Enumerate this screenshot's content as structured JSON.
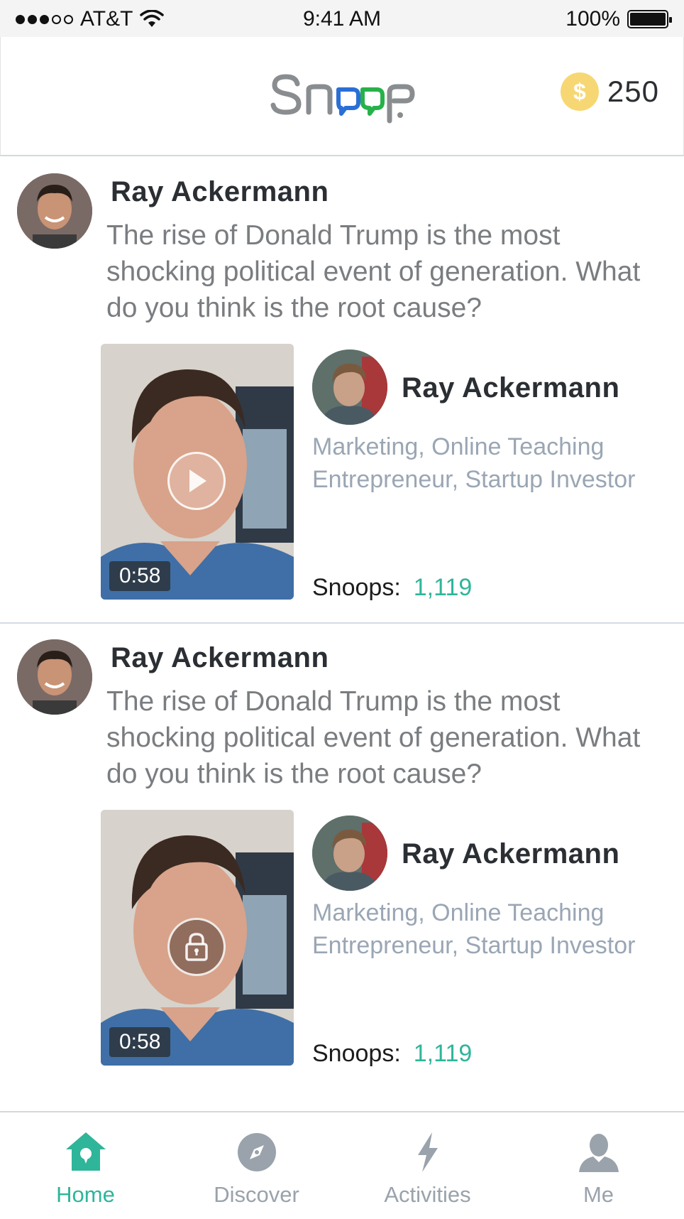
{
  "status_bar": {
    "carrier": "AT&T",
    "time": "9:41 AM",
    "battery": "100%",
    "signal_bars_filled": 3,
    "signal_bars_total": 5
  },
  "header": {
    "logo_text": "Snoop",
    "coin_symbol": "$",
    "coin_count": "250"
  },
  "posts": [
    {
      "asker_name": "Ray Ackermann",
      "question": "The rise of Donald Trump is the most shocking political event of generation. What do you think is the root cause?",
      "video_duration": "0:58",
      "video_state": "play",
      "answerer_name": "Ray Ackermann",
      "answerer_tags": "Marketing, Online Teaching Entrepreneur, Startup Investor",
      "snoops_label": "Snoops:",
      "snoops_count": "1,119"
    },
    {
      "asker_name": "Ray Ackermann",
      "question": "The rise of Donald Trump is the most shocking political event of generation. What do you think is the root cause?",
      "video_duration": "0:58",
      "video_state": "locked",
      "answerer_name": "Ray Ackermann",
      "answerer_tags": "Marketing, Online Teaching Entrepreneur, Startup Investor",
      "snoops_label": "Snoops:",
      "snoops_count": "1,119"
    }
  ],
  "tabs": [
    {
      "label": "Home",
      "icon": "home-icon",
      "active": true
    },
    {
      "label": "Discover",
      "icon": "compass-icon",
      "active": false
    },
    {
      "label": "Activities",
      "icon": "lightning-icon",
      "active": false
    },
    {
      "label": "Me",
      "icon": "person-icon",
      "active": false
    }
  ],
  "colors": {
    "accent": "#2fb59a",
    "tab_inactive": "#9aa2ab",
    "coin": "#f7d774",
    "tag_text": "#9aa6b4"
  }
}
